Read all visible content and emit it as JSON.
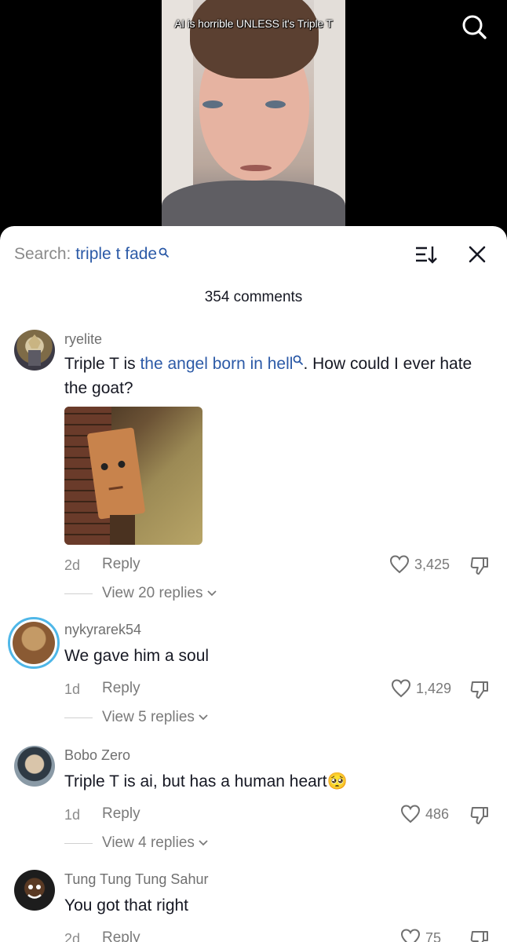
{
  "video": {
    "caption": "AI is horrible UNLESS it's Triple T",
    "search_icon": "search-icon"
  },
  "sheet": {
    "search_prefix": "Search:",
    "search_term": "triple t fade",
    "sort_icon": "sort-icon",
    "close_icon": "close-icon",
    "comment_count": "354 comments"
  },
  "comments": [
    {
      "username": "ryelite",
      "text_before": "Triple T is ",
      "text_highlight": "the angel born in hell",
      "text_after": ". How could I ever hate the goat?",
      "has_image": true,
      "date": "2d",
      "reply": "Reply",
      "likes": "3,425",
      "view_replies": "View 20 replies"
    },
    {
      "username": "nykyrarek54",
      "text": "We gave him a soul",
      "date": "1d",
      "reply": "Reply",
      "likes": "1,429",
      "view_replies": "View 5 replies"
    },
    {
      "username": "Bobo Zero",
      "text": "Triple T is ai, but has a human heart",
      "emoji": "🥺",
      "date": "1d",
      "reply": "Reply",
      "likes": "486",
      "view_replies": "View 4 replies"
    },
    {
      "username": "Tung Tung Tung Sahur",
      "text": "You got that right",
      "date": "2d",
      "reply": "Reply",
      "likes": "75"
    }
  ],
  "colors": {
    "link": "#2c5aa7",
    "muted": "#8a8a8a",
    "text": "#161823"
  }
}
